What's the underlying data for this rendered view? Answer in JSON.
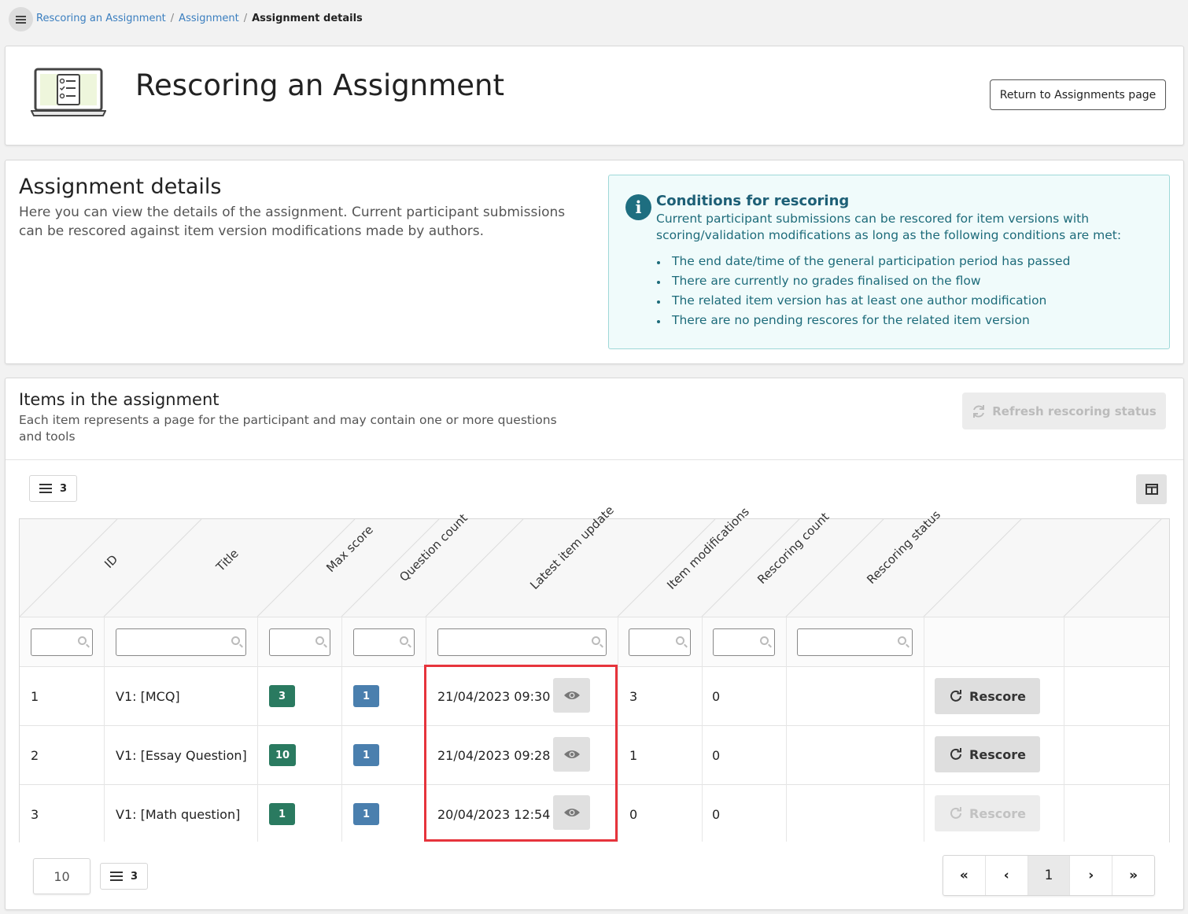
{
  "breadcrumb": [
    "Rescoring an Assignment",
    "Assignment",
    "Assignment details"
  ],
  "header": {
    "title": "Rescoring an Assignment",
    "return_button": "Return to Assignments page"
  },
  "details": {
    "title": "Assignment details",
    "description": "Here you can view the details of the assignment. Current participant submissions can be rescored against item version modifications made by authors.",
    "conditions": {
      "title": "Conditions for rescoring",
      "description": "Current participant submissions can be rescored for item versions with scoring/validation modifications as long as the following conditions are met:",
      "items": [
        "The end date/time of the general participation period has passed",
        "There are currently no grades finalised on the flow",
        "The related item version has at least one author modification",
        "There are no pending rescores for the related item version"
      ]
    }
  },
  "items_section": {
    "title": "Items in the assignment",
    "subtitle": "Each item represents a page for the participant and may contain one or more questions and tools",
    "refresh_button": "Refresh rescoring status",
    "row_count": "3",
    "columns": [
      "ID",
      "Title",
      "Max score",
      "Question count",
      "Latest item update",
      "Item modifications",
      "Rescoring count",
      "Rescoring status"
    ],
    "rows": [
      {
        "id": "1",
        "title": "V1: [MCQ]",
        "max_score": "3",
        "question_count": "1",
        "latest_update": "21/04/2023 09:30",
        "modifications": "3",
        "rescoring_count": "0",
        "rescoring_status": "",
        "action": "Rescore",
        "action_enabled": true
      },
      {
        "id": "2",
        "title": "V1: [Essay Question]",
        "max_score": "10",
        "question_count": "1",
        "latest_update": "21/04/2023 09:28",
        "modifications": "1",
        "rescoring_count": "0",
        "rescoring_status": "",
        "action": "Rescore",
        "action_enabled": true
      },
      {
        "id": "3",
        "title": "V1: [Math question]",
        "max_score": "1",
        "question_count": "1",
        "latest_update": "20/04/2023 12:54",
        "modifications": "0",
        "rescoring_count": "0",
        "rescoring_status": "",
        "action": "Rescore",
        "action_enabled": false
      }
    ],
    "page_size": "10",
    "footer_count": "3",
    "pagination": {
      "first": "«",
      "prev": "‹",
      "current": "1",
      "next": "›",
      "last": "»"
    }
  },
  "colors": {
    "link": "#3a7ebf",
    "badge_green": "#2a7a60",
    "badge_blue": "#4a7fae",
    "highlight": "#e6343c",
    "info": "#1e6e80"
  }
}
